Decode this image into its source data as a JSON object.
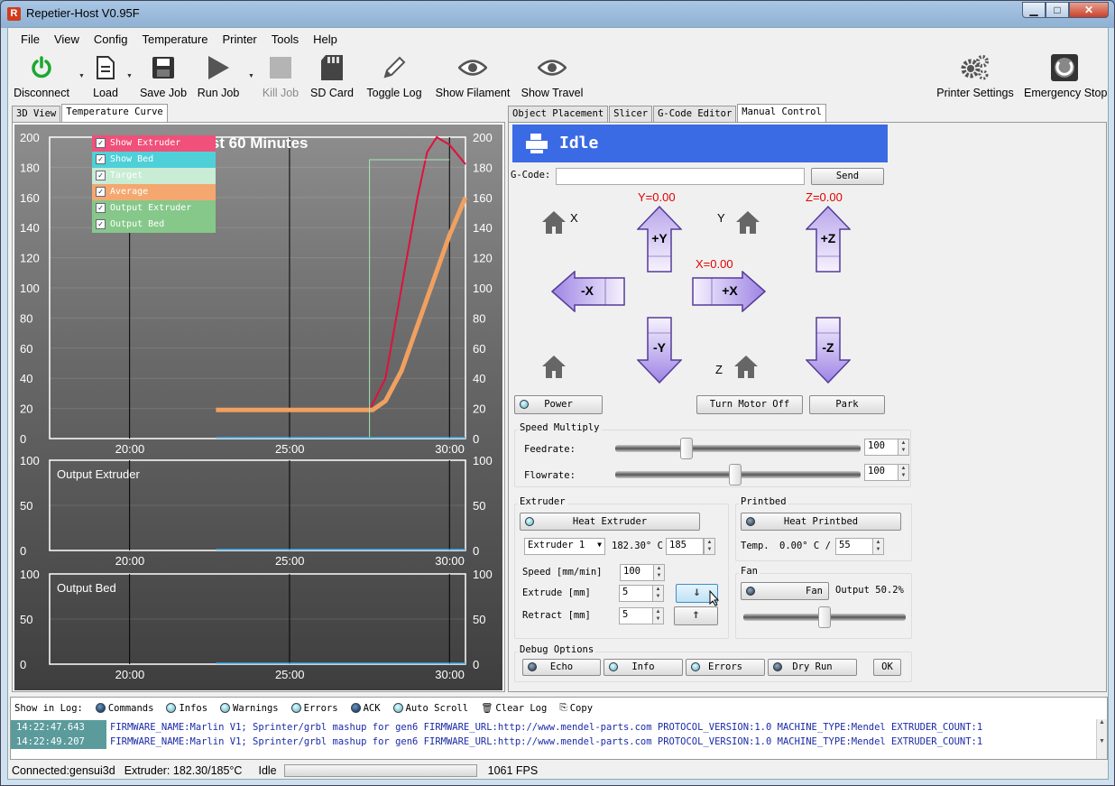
{
  "window": {
    "title": "Repetier-Host V0.95F",
    "icon_letter": "R"
  },
  "menu": [
    "File",
    "View",
    "Config",
    "Temperature",
    "Printer",
    "Tools",
    "Help"
  ],
  "toolbar": {
    "disconnect": "Disconnect",
    "load": "Load",
    "save_job": "Save Job",
    "run_job": "Run Job",
    "kill_job": "Kill Job",
    "sd_card": "SD Card",
    "toggle_log": "Toggle Log",
    "show_filament": "Show Filament",
    "show_travel": "Show Travel",
    "printer_settings": "Printer Settings",
    "emergency_stop": "Emergency Stop"
  },
  "left_tabs": [
    "3D View",
    "Temperature Curve"
  ],
  "right_tabs": [
    "Object Placement",
    "Slicer",
    "G-Code Editor",
    "Manual Control"
  ],
  "chart_data": {
    "type": "line",
    "title": "Past 60 Minutes",
    "legend": [
      "Show Extruder",
      "Show Bed",
      "Target",
      "Average",
      "Output Extruder",
      "Output Bed"
    ],
    "legend_colors": [
      "#f0507a",
      "#4fd0d8",
      "#c8ecd4",
      "#f4a870",
      "#86c88a",
      "#86c88a"
    ],
    "x_ticks": [
      "20:00",
      "25:00",
      "30:00"
    ],
    "y_ticks": [
      "200",
      "180",
      "160",
      "140",
      "120",
      "100",
      "80",
      "60",
      "40",
      "20",
      "0"
    ],
    "ylim": [
      0,
      200
    ],
    "xlim_minutes": [
      17.5,
      30.5
    ],
    "series": [
      {
        "name": "Show Extruder",
        "color": "#e0103c",
        "x": [
          22.7,
          27.5,
          28.0,
          28.5,
          29.0,
          29.3,
          29.6,
          30.0,
          30.5
        ],
        "y": [
          19,
          19,
          40,
          100,
          160,
          190,
          200,
          195,
          182
        ]
      },
      {
        "name": "Average",
        "color": "#f0a060",
        "x": [
          22.7,
          27.6,
          28.0,
          28.5,
          29.0,
          29.5,
          30.0,
          30.5
        ],
        "y": [
          19,
          19,
          25,
          45,
          75,
          105,
          135,
          160
        ]
      },
      {
        "name": "Target",
        "color": "#a8e8b0",
        "x": [
          27.5,
          27.5,
          30.0
        ],
        "y": [
          0,
          185,
          185
        ]
      }
    ],
    "sub_charts": [
      {
        "title": "Output Extruder",
        "y_ticks": [
          "100",
          "50",
          "0"
        ],
        "x_ticks": [
          "20:00",
          "25:00",
          "30:00"
        ]
      },
      {
        "title": "Output Bed",
        "y_ticks": [
          "100",
          "50",
          "0"
        ],
        "x_ticks": [
          "20:00",
          "25:00",
          "30:00"
        ]
      }
    ]
  },
  "manual": {
    "status": "Idle",
    "gcode_label": "G-Code:",
    "send": "Send",
    "y_pos": "Y=0.00",
    "x_pos": "X=0.00",
    "z_pos": "Z=0.00",
    "home_x": "X",
    "home_y": "Y",
    "home_z": "Z",
    "plus_y": "+Y",
    "minus_y": "-Y",
    "plus_x": "+X",
    "minus_x": "-X",
    "plus_z": "+Z",
    "minus_z": "-Z",
    "power": "Power",
    "turn_motor_off": "Turn Motor Off",
    "park": "Park",
    "speed_multiply": "Speed Multiply",
    "feedrate_label": "Feedrate:",
    "feedrate": "100",
    "feedrate_level": 0.28,
    "flowrate_label": "Flowrate:",
    "flowrate": "100",
    "flowrate_level": 0.49,
    "extruder_group": "Extruder",
    "heat_extruder": "Heat Extruder",
    "extruder_select": "Extruder 1",
    "extruder_temp": "182.30° C /",
    "extruder_target": "185",
    "speed_label": "Speed [mm/min]",
    "speed": "100",
    "extrude_label": "Extrude [mm]",
    "extrude": "5",
    "retract_label": "Retract [mm]",
    "retract": "5",
    "printbed_group": "Printbed",
    "heat_printbed": "Heat Printbed",
    "bed_temp_label": "Temp.",
    "bed_temp": "0.00° C /",
    "bed_target": "55",
    "fan_group": "Fan",
    "fan": "Fan",
    "fan_output": "Output 50.2%",
    "fan_level": 0.5,
    "debug_group": "Debug Options",
    "echo": "Echo",
    "info": "Info",
    "errors": "Errors",
    "dry_run": "Dry Run",
    "ok": "OK"
  },
  "log": {
    "show_in_log": "Show in Log:",
    "options": [
      "Commands",
      "Infos",
      "Warnings",
      "Errors",
      "ACK",
      "Auto Scroll"
    ],
    "clear_log": "Clear Log",
    "copy": "Copy",
    "lines": [
      {
        "time": "14:22:47.643",
        "msg": "FIRMWARE_NAME:Marlin V1; Sprinter/grbl mashup for gen6 FIRMWARE_URL:http://www.mendel-parts.com PROTOCOL_VERSION:1.0 MACHINE_TYPE:Mendel EXTRUDER_COUNT:1"
      },
      {
        "time": "14:22:49.207",
        "msg": "FIRMWARE_NAME:Marlin V1; Sprinter/grbl mashup for gen6 FIRMWARE_URL:http://www.mendel-parts.com PROTOCOL_VERSION:1.0 MACHINE_TYPE:Mendel EXTRUDER_COUNT:1"
      }
    ]
  },
  "status": {
    "connected": "Connected:gensui3d",
    "extruder": "Extruder: 182.30/185°C",
    "state": "Idle",
    "fps": "1061 FPS"
  }
}
